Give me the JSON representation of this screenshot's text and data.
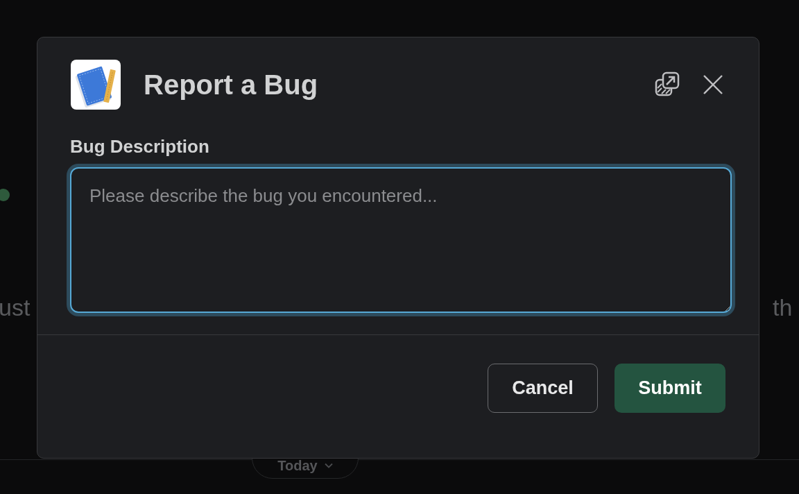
{
  "background": {
    "text_left": "ust",
    "text_right": "th",
    "date_pill": {
      "label": "Today"
    }
  },
  "dialog": {
    "title": "Report a Bug",
    "field": {
      "label": "Bug Description",
      "placeholder": "Please describe the bug you encountered...",
      "focused": true
    },
    "buttons": [
      {
        "label": "Cancel",
        "kind": "secondary"
      },
      {
        "label": "Submit",
        "kind": "primary"
      }
    ]
  }
}
